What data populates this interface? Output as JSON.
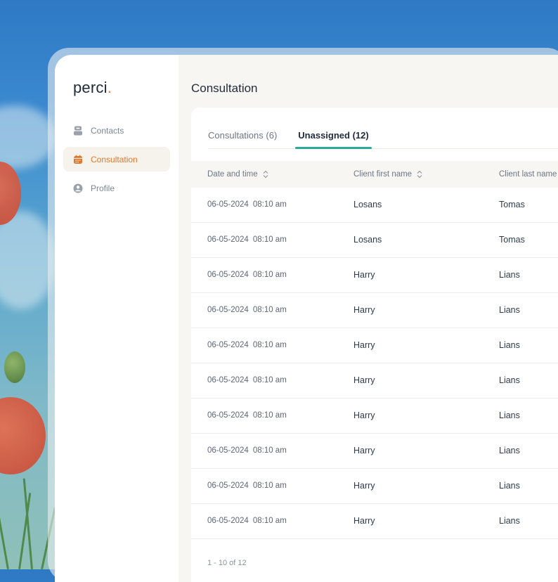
{
  "sidebar": {
    "logo": "perci",
    "logo_dot": ".",
    "items": [
      {
        "label": "Contacts",
        "icon": "contacts-icon",
        "active": false
      },
      {
        "label": "Consultation",
        "icon": "calendar-icon",
        "active": true
      },
      {
        "label": "Profile",
        "icon": "profile-icon",
        "active": false
      }
    ]
  },
  "main": {
    "title": "Consultation",
    "tabs": [
      {
        "label": "Consultations (6)",
        "active": false
      },
      {
        "label": "Unassigned (12)",
        "active": true
      }
    ],
    "table": {
      "columns": [
        "Date and time",
        "Client first name",
        "Client last name"
      ],
      "rows": [
        {
          "date": "06-05-2024",
          "time": "08:10 am",
          "first": "Losans",
          "last": "Tomas"
        },
        {
          "date": "06-05-2024",
          "time": "08:10 am",
          "first": "Losans",
          "last": "Tomas"
        },
        {
          "date": "06-05-2024",
          "time": "08:10 am",
          "first": "Harry",
          "last": "Lians"
        },
        {
          "date": "06-05-2024",
          "time": "08:10 am",
          "first": "Harry",
          "last": "Lians"
        },
        {
          "date": "06-05-2024",
          "time": "08:10 am",
          "first": "Harry",
          "last": "Lians"
        },
        {
          "date": "06-05-2024",
          "time": "08:10 am",
          "first": "Harry",
          "last": "Lians"
        },
        {
          "date": "06-05-2024",
          "time": "08:10 am",
          "first": "Harry",
          "last": "Lians"
        },
        {
          "date": "06-05-2024",
          "time": "08:10 am",
          "first": "Harry",
          "last": "Lians"
        },
        {
          "date": "06-05-2024",
          "time": "08:10 am",
          "first": "Harry",
          "last": "Lians"
        },
        {
          "date": "06-05-2024",
          "time": "08:10 am",
          "first": "Harry",
          "last": "Lians"
        }
      ]
    },
    "pagination": "1 - 10 of 12"
  },
  "colors": {
    "accent": "#e0782c",
    "tab_underline": "#2aa89a",
    "title": "#1f2b3c"
  }
}
